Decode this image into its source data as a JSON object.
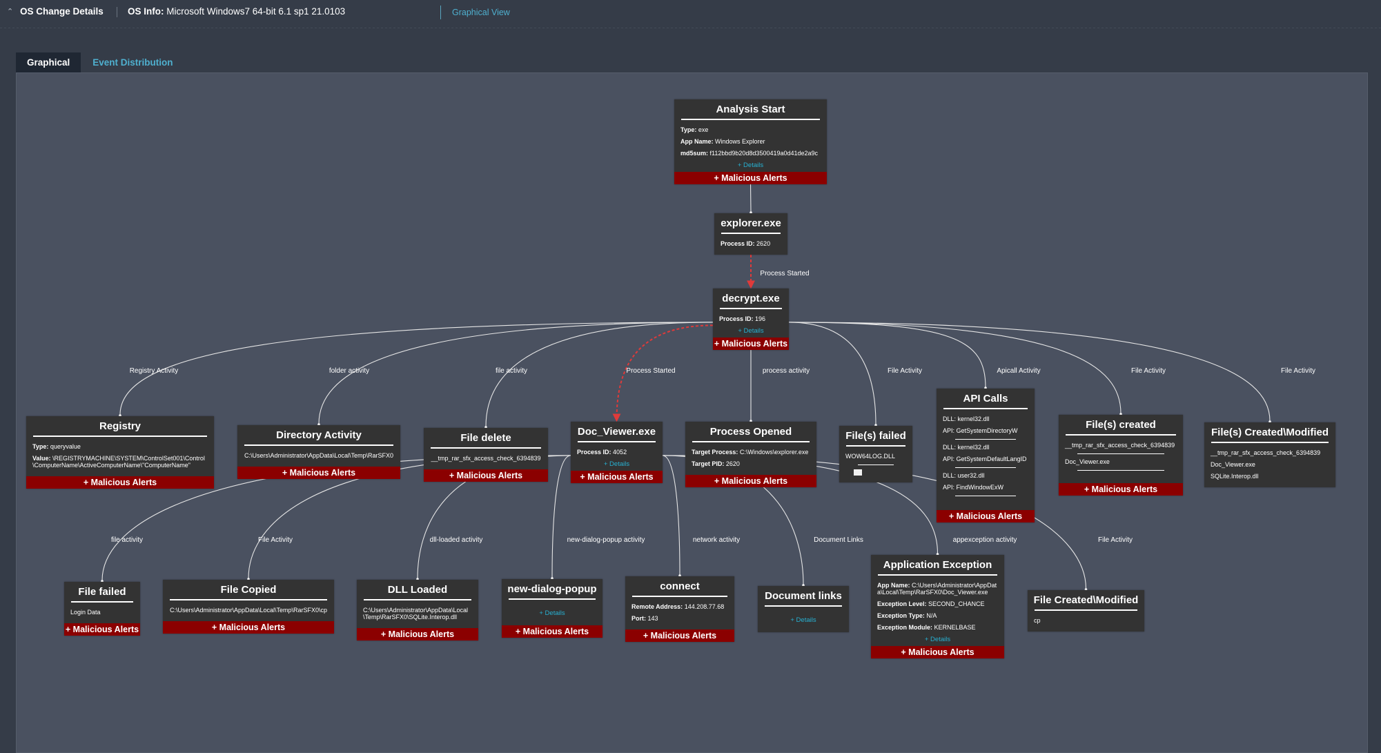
{
  "header": {
    "collapse_icon": "caret-up-icon",
    "title": "OS Change Details",
    "os_info_label": "OS Info:",
    "os_info_value": "Microsoft Windows7 64-bit 6.1 sp1 21.0103",
    "view_link": "Graphical View"
  },
  "tabs": [
    {
      "label": "Graphical",
      "active": true
    },
    {
      "label": "Event Distribution",
      "active": false
    }
  ],
  "common": {
    "alerts_label": "+ Malicious Alerts",
    "details_label": "+ Details"
  },
  "nodes": {
    "analysis_start": {
      "title": "Analysis Start",
      "lines": [
        {
          "k": "Type:",
          "v": "exe"
        },
        {
          "k": "App Name:",
          "v": "Windows Explorer"
        },
        {
          "k": "md5sum:",
          "v": "f112bbd9b20d8d3500419a0d41de2a9c"
        }
      ],
      "has_details": true,
      "has_alerts": true
    },
    "explorer": {
      "title": "explorer.exe",
      "lines": [
        {
          "k": "Process ID:",
          "v": "2620"
        }
      ],
      "has_details": false,
      "has_alerts": false
    },
    "decrypt": {
      "title": "decrypt.exe",
      "lines": [
        {
          "k": "Process ID:",
          "v": "196"
        }
      ],
      "has_details": true,
      "has_alerts": true
    },
    "registry": {
      "title": "Registry",
      "lines": [
        {
          "k": "Type:",
          "v": "queryvalue"
        },
        {
          "k": "Value:",
          "v": "\\REGISTRYMACHINE\\SYSTEM\\ControlSet001\\Control\\ComputerName\\ActiveComputerName\\\"ComputerName\""
        }
      ],
      "has_alerts": true
    },
    "directory_activity": {
      "title": "Directory Activity",
      "lines": [
        {
          "v": "C:\\Users\\Administrator\\AppData\\Local\\Temp\\RarSFX0"
        }
      ],
      "has_alerts": true
    },
    "file_delete": {
      "title": "File delete",
      "lines": [
        {
          "v": "__tmp_rar_sfx_access_check_6394839"
        }
      ],
      "has_alerts": true
    },
    "doc_viewer": {
      "title": "Doc_Viewer.exe",
      "lines": [
        {
          "k": "Process ID:",
          "v": "4052"
        }
      ],
      "has_details": true,
      "has_alerts": true
    },
    "process_opened": {
      "title": "Process Opened",
      "lines": [
        {
          "k": "Target Process:",
          "v": "C:\\Windows\\explorer.exe"
        },
        {
          "k": "Target PID:",
          "v": "2620"
        }
      ],
      "has_alerts": true
    },
    "files_failed": {
      "title": "File(s) failed",
      "lines": [
        {
          "v": "WOW64LOG.DLL"
        }
      ],
      "icon": "file-box-icon",
      "has_alerts": false
    },
    "api_calls": {
      "title": "API Calls",
      "groups": [
        {
          "dll": "kernel32.dll",
          "api": "GetSystemDirectoryW"
        },
        {
          "dll": "kernel32.dll",
          "api": "GetSystemDefaultLangID"
        },
        {
          "dll": "user32.dll",
          "api": "FindWindowExW"
        }
      ],
      "dll_label": "DLL:",
      "api_label": "API:",
      "has_alerts": true
    },
    "files_created": {
      "title": "File(s) created",
      "items": [
        "__tmp_rar_sfx_access_check_6394839",
        "Doc_Viewer.exe"
      ],
      "has_alerts": true
    },
    "files_created_modified": {
      "title": "File(s) Created\\Modified",
      "items": [
        "__tmp_rar_sfx_access_check_6394839",
        "Doc_Viewer.exe",
        "SQLite.Interop.dll"
      ],
      "has_alerts": false
    },
    "file_failed": {
      "title": "File failed",
      "lines": [
        {
          "v": "Login Data"
        }
      ],
      "has_alerts": true
    },
    "file_copied": {
      "title": "File Copied",
      "lines": [
        {
          "v": "C:\\Users\\Administrator\\AppData\\Local\\Temp\\RarSFX0\\cp"
        }
      ],
      "has_alerts": true
    },
    "dll_loaded": {
      "title": "DLL Loaded",
      "lines": [
        {
          "v": "C:\\Users\\Administrator\\AppData\\Local\\Temp\\RarSFX0\\SQLite.Interop.dll"
        }
      ],
      "has_alerts": true
    },
    "new_dialog_popup": {
      "title": "new-dialog-popup",
      "lines": [],
      "has_details": true,
      "has_alerts": true
    },
    "connect": {
      "title": "connect",
      "lines": [
        {
          "k": "Remote Address:",
          "v": "144.208.77.68"
        },
        {
          "k": "Port:",
          "v": "143"
        }
      ],
      "has_alerts": true
    },
    "document_links": {
      "title": "Document links",
      "lines": [],
      "has_details": true,
      "has_alerts": false
    },
    "application_exception": {
      "title": "Application Exception",
      "lines": [
        {
          "k": "App Name:",
          "v": "C:\\Users\\Administrator\\AppData\\Local\\Temp\\RarSFX0\\Doc_Viewer.exe"
        },
        {
          "k": "Exception Level:",
          "v": "SECOND_CHANCE"
        },
        {
          "k": "Exception Type:",
          "v": "N/A"
        },
        {
          "k": "Exception Module:",
          "v": "KERNELBASE"
        }
      ],
      "has_details": true,
      "has_alerts": true
    },
    "file_created_modified": {
      "title": "File Created\\Modified",
      "lines": [
        {
          "v": "cp"
        }
      ],
      "has_alerts": false
    }
  },
  "edges": [
    {
      "from": "analysis_start",
      "to": "explorer",
      "label": "",
      "style": "solid"
    },
    {
      "from": "explorer",
      "to": "decrypt",
      "label": "Process Started",
      "style": "dashed-red"
    },
    {
      "from": "decrypt",
      "to": "registry",
      "label": "Registry Activity",
      "style": "solid"
    },
    {
      "from": "decrypt",
      "to": "directory_activity",
      "label": "folder activity",
      "style": "solid"
    },
    {
      "from": "decrypt",
      "to": "file_delete",
      "label": "file activity",
      "style": "solid"
    },
    {
      "from": "decrypt",
      "to": "doc_viewer",
      "label": "Process Started",
      "style": "dashed-red"
    },
    {
      "from": "decrypt",
      "to": "process_opened",
      "label": "process activity",
      "style": "solid"
    },
    {
      "from": "decrypt",
      "to": "files_failed",
      "label": "File Activity",
      "style": "solid"
    },
    {
      "from": "decrypt",
      "to": "api_calls",
      "label": "Apicall Activity",
      "style": "solid"
    },
    {
      "from": "decrypt",
      "to": "files_created",
      "label": "File Activity",
      "style": "solid"
    },
    {
      "from": "decrypt",
      "to": "files_created_modified",
      "label": "File Activity",
      "style": "solid"
    },
    {
      "from": "doc_viewer",
      "to": "file_failed",
      "label": "file activity",
      "style": "solid"
    },
    {
      "from": "doc_viewer",
      "to": "file_copied",
      "label": "File Activity",
      "style": "solid"
    },
    {
      "from": "doc_viewer",
      "to": "dll_loaded",
      "label": "dll-loaded activity",
      "style": "solid"
    },
    {
      "from": "doc_viewer",
      "to": "new_dialog_popup",
      "label": "new-dialog-popup activity",
      "style": "solid"
    },
    {
      "from": "doc_viewer",
      "to": "connect",
      "label": "network activity",
      "style": "solid"
    },
    {
      "from": "doc_viewer",
      "to": "document_links",
      "label": "Document Links",
      "style": "solid"
    },
    {
      "from": "doc_viewer",
      "to": "application_exception",
      "label": "appexception activity",
      "style": "solid"
    },
    {
      "from": "doc_viewer",
      "to": "file_created_modified",
      "label": "File Activity",
      "style": "solid"
    }
  ],
  "colors": {
    "alert": "#8b0000",
    "details_link": "#27b1d2",
    "process_edge": "#e03a3a",
    "link_text": "#4fb0cf"
  }
}
